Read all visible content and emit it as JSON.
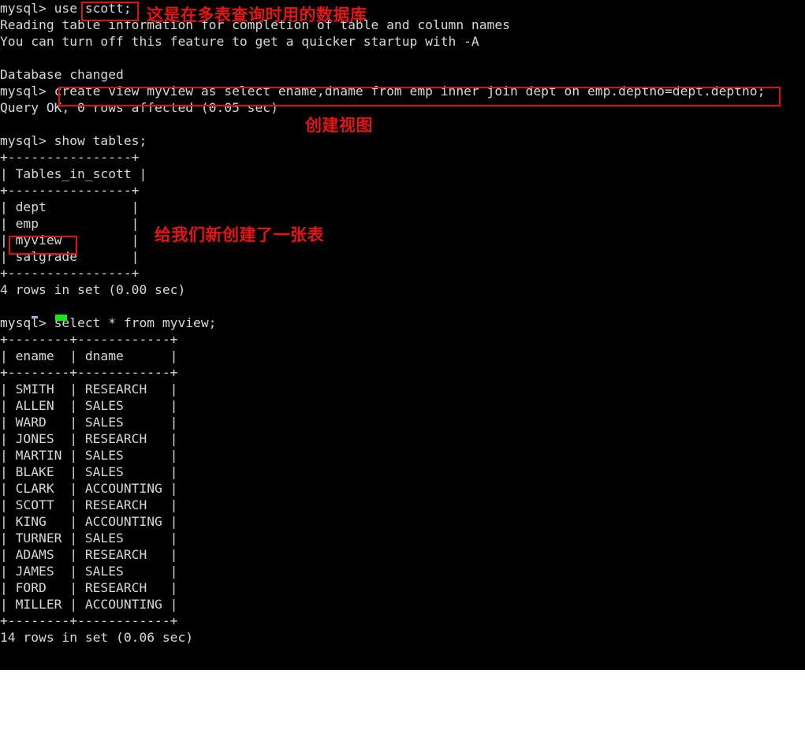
{
  "terminal": {
    "prompt": "mysql> ",
    "lines": [
      "mysql> use scott;",
      "Reading table information for completion of table and column names",
      "You can turn off this feature to get a quicker startup with -A",
      "",
      "Database changed",
      "mysql> create view myview as select ename,dname from emp inner join dept on emp.deptno=dept.deptno;",
      "Query OK, 0 rows affected (0.05 sec)",
      "",
      "mysql> show tables;",
      "+----------------+",
      "| Tables_in_scott |",
      "+----------------+",
      "| dept           |",
      "| emp            |",
      "| myview         |",
      "| salgrade       |",
      "+----------------+",
      "4 rows in set (0.00 sec)",
      "",
      "mysql> select * from myview;",
      "+--------+------------+",
      "| ename  | dname      |",
      "+--------+------------+",
      "| SMITH  | RESEARCH   |",
      "| ALLEN  | SALES      |",
      "| WARD   | SALES      |",
      "| JONES  | RESEARCH   |",
      "| MARTIN | SALES      |",
      "| BLAKE  | SALES      |",
      "| CLARK  | ACCOUNTING |",
      "| SCOTT  | RESEARCH   |",
      "| KING   | ACCOUNTING |",
      "| TURNER | SALES      |",
      "| ADAMS  | RESEARCH   |",
      "| JAMES  | SALES      |",
      "| FORD   | RESEARCH   |",
      "| MILLER | ACCOUNTING |",
      "+--------+------------+",
      "14 rows in set (0.06 sec)"
    ],
    "commands": {
      "use_db": "use scott;",
      "create_view": "create view myview as select ename,dname from emp inner join dept on emp.deptno=dept.deptno;",
      "show_tables": "show tables;",
      "select_view": "select * from myview;"
    },
    "messages": {
      "reading_info": "Reading table information for completion of table and column names",
      "turn_off": "You can turn off this feature to get a quicker startup with -A",
      "db_changed": "Database changed",
      "query_ok": "Query OK, 0 rows affected (0.05 sec)",
      "rows_tables": "4 rows in set (0.00 sec)",
      "rows_view": "14 rows in set (0.06 sec)"
    },
    "tables": {
      "show_tables": {
        "header": "Tables_in_scott",
        "rows": [
          "dept",
          "emp",
          "myview",
          "salgrade"
        ],
        "row_count": 4
      },
      "myview_result": {
        "headers": [
          "ename",
          "dname"
        ],
        "rows": [
          [
            "SMITH",
            "RESEARCH"
          ],
          [
            "ALLEN",
            "SALES"
          ],
          [
            "WARD",
            "SALES"
          ],
          [
            "JONES",
            "RESEARCH"
          ],
          [
            "MARTIN",
            "SALES"
          ],
          [
            "BLAKE",
            "SALES"
          ],
          [
            "CLARK",
            "ACCOUNTING"
          ],
          [
            "SCOTT",
            "RESEARCH"
          ],
          [
            "KING",
            "ACCOUNTING"
          ],
          [
            "TURNER",
            "SALES"
          ],
          [
            "ADAMS",
            "RESEARCH"
          ],
          [
            "JAMES",
            "SALES"
          ],
          [
            "FORD",
            "RESEARCH"
          ],
          [
            "MILLER",
            "ACCOUNTING"
          ]
        ],
        "row_count": 14
      }
    }
  },
  "annotations": {
    "database_note": "这是在多表查询时用的数据库",
    "create_view_note": "创建视图",
    "new_table_note": "给我们新创建了一张表",
    "highlight_color": "#e01010",
    "text_color": "#e81414"
  },
  "cursor": {
    "color": "#14e814"
  }
}
